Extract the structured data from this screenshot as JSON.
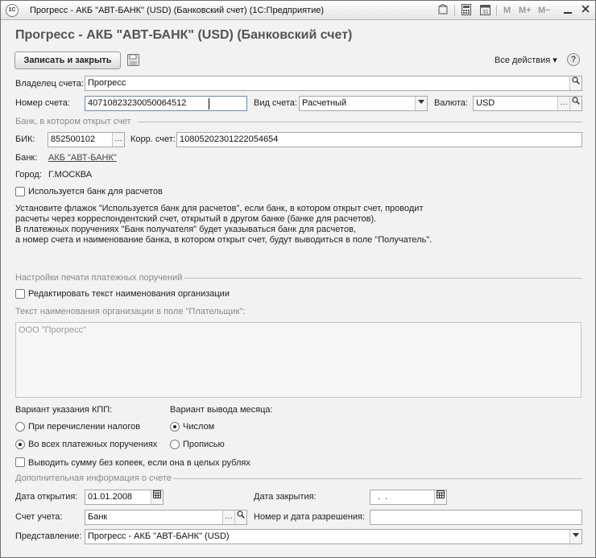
{
  "window": {
    "app_icon": "1C",
    "title": "Прогресс - АКБ \"АВТ-БАНК\" (USD) (Банковский счет)  (1С:Предприятие)",
    "toolbar": {
      "m": "M",
      "m_plus": "M+",
      "m_minus": "M−"
    }
  },
  "form": {
    "title": "Прогресс - АКБ \"АВТ-БАНК\" (USD) (Банковский счет)",
    "save_close_label": "Записать и закрыть",
    "all_actions_label": "Все действия ▾",
    "help_label": "?"
  },
  "fields": {
    "owner": {
      "label": "Владелец счета:",
      "value": "Прогресс"
    },
    "account_number": {
      "label": "Номер счета:",
      "value": "40710823230050064512"
    },
    "account_type": {
      "label": "Вид счета:",
      "value": "Расчетный"
    },
    "currency": {
      "label": "Валюта:",
      "value": "USD"
    }
  },
  "bank_section": {
    "title": "Банк, в котором открыт счет",
    "bik_label": "БИК:",
    "bik_value": "852500102",
    "corr_label": "Корр. счет:",
    "corr_value": "10805202301222054654",
    "bank_label": "Банк:",
    "bank_value": "АКБ \"АВТ-БАНК\"",
    "city_label": "Город:",
    "city_value": "Г.МОСКВА",
    "use_bank_label": "Используется банк для расчетов",
    "note_lines": [
      "Установите флажок \"Используется банк для расчетов\", если банк, в котором открыт счет, проводит",
      "расчеты через корреспондентский счет, открытый в другом банке (банке для расчетов).",
      "В платежных поручениях \"Банк получателя\" будет указываться банк для расчетов,",
      "а номер счета и наименование банка, в котором открыт счет, будут выводиться в поле \"Получатель\"."
    ]
  },
  "print_section": {
    "title": "Настройки печати платежных поручений",
    "edit_org_label": "Редактировать текст наименования организации",
    "org_text_label": "Текст наименования организации в поле \"Плательщик\":",
    "org_text_value": "ООО \"Прогресс\"",
    "kpp_label": "Вариант указания КПП:",
    "kpp_options": [
      "При перечислении налогов",
      "Во всех платежных поручениях"
    ],
    "kpp_selected": 1,
    "month_label": "Вариант вывода месяца:",
    "month_options": [
      "Числом",
      "Прописью"
    ],
    "month_selected": 0,
    "no_kopecks_label": "Выводить сумму без копеек, если она в целых рублях"
  },
  "extra_section": {
    "title": "Дополнительная информация о счете",
    "open_date_label": "Дата открытия:",
    "open_date_value": "01.01.2008",
    "close_date_label": "Дата закрытия:",
    "close_date_value": "  .  .",
    "account_label": "Счет учета:",
    "account_value": "Банк",
    "permit_label": "Номер и дата разрешения:",
    "permit_value": "",
    "representation_label": "Представление:",
    "representation_value": "Прогресс - АКБ \"АВТ-БАНК\" (USD)"
  },
  "icons": {
    "search": "magnifier-icon",
    "select": "ellipsis-icon",
    "dropdown": "triangle-down-icon",
    "calendar": "calendar-icon",
    "save": "floppy-disk-icon"
  }
}
